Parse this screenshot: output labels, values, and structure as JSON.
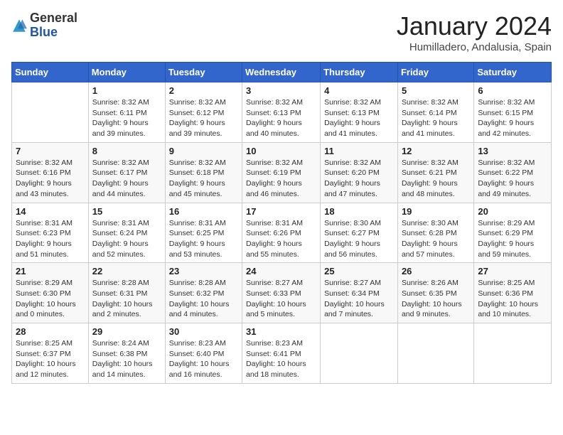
{
  "header": {
    "logo_general": "General",
    "logo_blue": "Blue",
    "month_title": "January 2024",
    "location": "Humilladero, Andalusia, Spain"
  },
  "days_of_week": [
    "Sunday",
    "Monday",
    "Tuesday",
    "Wednesday",
    "Thursday",
    "Friday",
    "Saturday"
  ],
  "weeks": [
    [
      {
        "day": "",
        "info": ""
      },
      {
        "day": "1",
        "info": "Sunrise: 8:32 AM\nSunset: 6:11 PM\nDaylight: 9 hours\nand 39 minutes."
      },
      {
        "day": "2",
        "info": "Sunrise: 8:32 AM\nSunset: 6:12 PM\nDaylight: 9 hours\nand 39 minutes."
      },
      {
        "day": "3",
        "info": "Sunrise: 8:32 AM\nSunset: 6:13 PM\nDaylight: 9 hours\nand 40 minutes."
      },
      {
        "day": "4",
        "info": "Sunrise: 8:32 AM\nSunset: 6:13 PM\nDaylight: 9 hours\nand 41 minutes."
      },
      {
        "day": "5",
        "info": "Sunrise: 8:32 AM\nSunset: 6:14 PM\nDaylight: 9 hours\nand 41 minutes."
      },
      {
        "day": "6",
        "info": "Sunrise: 8:32 AM\nSunset: 6:15 PM\nDaylight: 9 hours\nand 42 minutes."
      }
    ],
    [
      {
        "day": "7",
        "info": "Sunrise: 8:32 AM\nSunset: 6:16 PM\nDaylight: 9 hours\nand 43 minutes."
      },
      {
        "day": "8",
        "info": "Sunrise: 8:32 AM\nSunset: 6:17 PM\nDaylight: 9 hours\nand 44 minutes."
      },
      {
        "day": "9",
        "info": "Sunrise: 8:32 AM\nSunset: 6:18 PM\nDaylight: 9 hours\nand 45 minutes."
      },
      {
        "day": "10",
        "info": "Sunrise: 8:32 AM\nSunset: 6:19 PM\nDaylight: 9 hours\nand 46 minutes."
      },
      {
        "day": "11",
        "info": "Sunrise: 8:32 AM\nSunset: 6:20 PM\nDaylight: 9 hours\nand 47 minutes."
      },
      {
        "day": "12",
        "info": "Sunrise: 8:32 AM\nSunset: 6:21 PM\nDaylight: 9 hours\nand 48 minutes."
      },
      {
        "day": "13",
        "info": "Sunrise: 8:32 AM\nSunset: 6:22 PM\nDaylight: 9 hours\nand 49 minutes."
      }
    ],
    [
      {
        "day": "14",
        "info": "Sunrise: 8:31 AM\nSunset: 6:23 PM\nDaylight: 9 hours\nand 51 minutes."
      },
      {
        "day": "15",
        "info": "Sunrise: 8:31 AM\nSunset: 6:24 PM\nDaylight: 9 hours\nand 52 minutes."
      },
      {
        "day": "16",
        "info": "Sunrise: 8:31 AM\nSunset: 6:25 PM\nDaylight: 9 hours\nand 53 minutes."
      },
      {
        "day": "17",
        "info": "Sunrise: 8:31 AM\nSunset: 6:26 PM\nDaylight: 9 hours\nand 55 minutes."
      },
      {
        "day": "18",
        "info": "Sunrise: 8:30 AM\nSunset: 6:27 PM\nDaylight: 9 hours\nand 56 minutes."
      },
      {
        "day": "19",
        "info": "Sunrise: 8:30 AM\nSunset: 6:28 PM\nDaylight: 9 hours\nand 57 minutes."
      },
      {
        "day": "20",
        "info": "Sunrise: 8:29 AM\nSunset: 6:29 PM\nDaylight: 9 hours\nand 59 minutes."
      }
    ],
    [
      {
        "day": "21",
        "info": "Sunrise: 8:29 AM\nSunset: 6:30 PM\nDaylight: 10 hours\nand 0 minutes."
      },
      {
        "day": "22",
        "info": "Sunrise: 8:28 AM\nSunset: 6:31 PM\nDaylight: 10 hours\nand 2 minutes."
      },
      {
        "day": "23",
        "info": "Sunrise: 8:28 AM\nSunset: 6:32 PM\nDaylight: 10 hours\nand 4 minutes."
      },
      {
        "day": "24",
        "info": "Sunrise: 8:27 AM\nSunset: 6:33 PM\nDaylight: 10 hours\nand 5 minutes."
      },
      {
        "day": "25",
        "info": "Sunrise: 8:27 AM\nSunset: 6:34 PM\nDaylight: 10 hours\nand 7 minutes."
      },
      {
        "day": "26",
        "info": "Sunrise: 8:26 AM\nSunset: 6:35 PM\nDaylight: 10 hours\nand 9 minutes."
      },
      {
        "day": "27",
        "info": "Sunrise: 8:25 AM\nSunset: 6:36 PM\nDaylight: 10 hours\nand 10 minutes."
      }
    ],
    [
      {
        "day": "28",
        "info": "Sunrise: 8:25 AM\nSunset: 6:37 PM\nDaylight: 10 hours\nand 12 minutes."
      },
      {
        "day": "29",
        "info": "Sunrise: 8:24 AM\nSunset: 6:38 PM\nDaylight: 10 hours\nand 14 minutes."
      },
      {
        "day": "30",
        "info": "Sunrise: 8:23 AM\nSunset: 6:40 PM\nDaylight: 10 hours\nand 16 minutes."
      },
      {
        "day": "31",
        "info": "Sunrise: 8:23 AM\nSunset: 6:41 PM\nDaylight: 10 hours\nand 18 minutes."
      },
      {
        "day": "",
        "info": ""
      },
      {
        "day": "",
        "info": ""
      },
      {
        "day": "",
        "info": ""
      }
    ]
  ]
}
